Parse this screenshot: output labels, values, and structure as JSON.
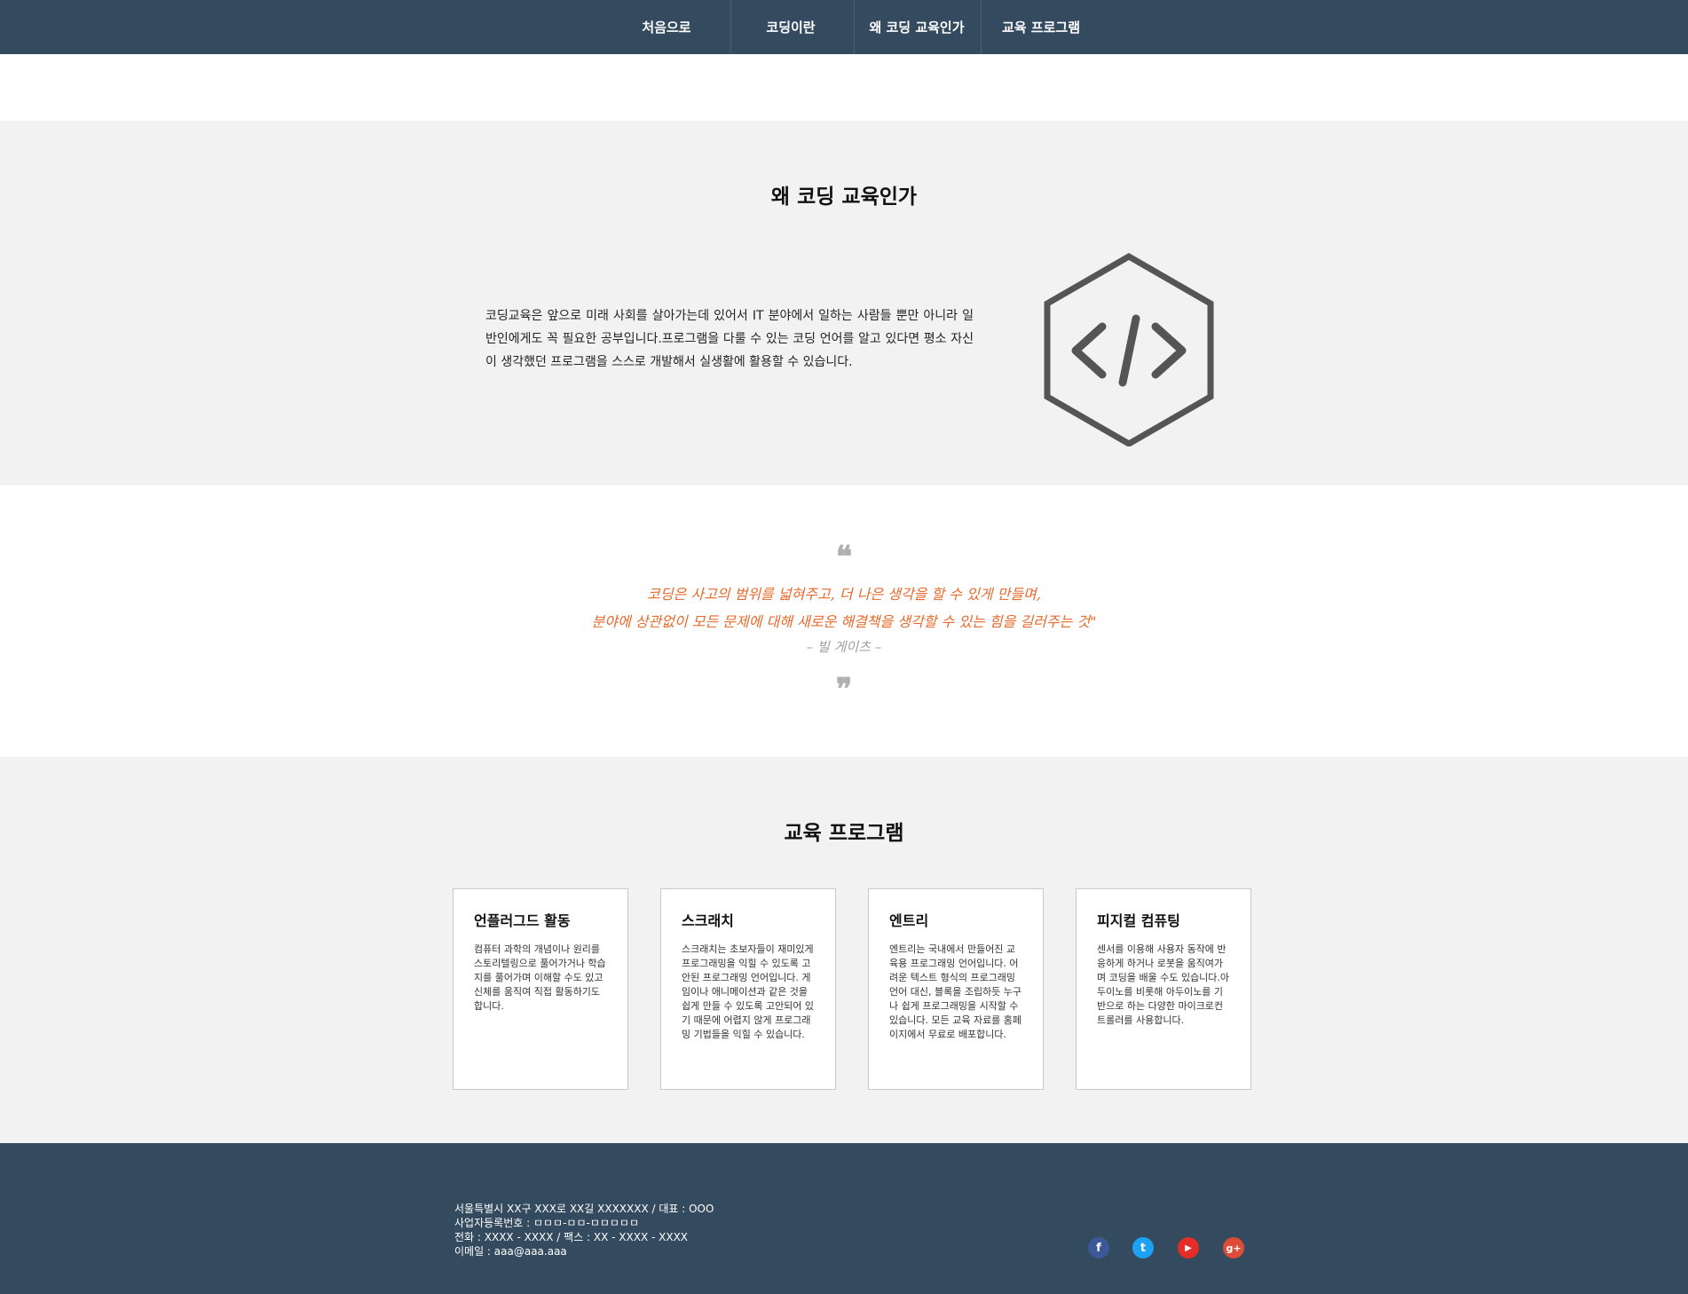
{
  "nav": {
    "items": [
      {
        "label": "처음으로"
      },
      {
        "label": "코딩이란"
      },
      {
        "label": "왜 코딩 교육인가"
      },
      {
        "label": "교육 프로그램"
      }
    ]
  },
  "why": {
    "title": "왜 코딩 교육인가",
    "text": "코딩교육은 앞으로 미래 사회를 살아가는데 있어서 IT 분야에서 일하는 사람들 뿐만 아니라 일반인에게도 꼭 필요한 공부입니다.프로그램을 다룰 수 있는 코딩 언어를 알고 있다면 평소 자신이 생각했던 프로그램을 스스로 개발해서 실생활에 활용할 수 있습니다.",
    "icon": "code-hexagon-icon"
  },
  "quote": {
    "open_mark": "❝",
    "line1": "코딩은 사고의 범위를 넓혀주고, 더 나은 생각을 할 수 있게 만들며,",
    "line2": "분야에 상관없이 모든 문제에 대해 새로운 해결책을 생각할 수 있는 힘을 길러주는 것\"",
    "author": "– 빌 게이츠 –",
    "close_mark": "❞",
    "accent_color": "#e8692c"
  },
  "programs": {
    "title": "교육 프로그램",
    "cards": [
      {
        "title": "언플러그드 활동",
        "body": "컴퓨터 과학의 개념이나 원리를 스토리텔링으로 풀어가거나 학습지를 풀어가며 이해할 수도 있고 신체를 움직여 직접 활동하기도 합니다."
      },
      {
        "title": "스크래치",
        "body": "스크래치는 초보자들이 재미있게 프로그래밍을 익힐 수 있도록 고안된 프로그래밍 언어입니다. 게임이나 애니메이션과 같은 것을 쉽게 만들 수 있도록 고안되어 있기 때문에 어렵지 않게 프로그래밍 기법들을 익힐 수 있습니다."
      },
      {
        "title": "엔트리",
        "body": "엔트리는 국내에서 만들어진 교육용 프로그래밍 언어입니다. 어려운 텍스트 형식의 프로그래밍 언어 대신, 블록을 조립하듯 누구나 쉽게 프로그래밍을 시작할 수 있습니다. 모든 교육 자료를 홈페이지에서 무료로 배포합니다."
      },
      {
        "title": "피지컬 컴퓨팅",
        "body": "센서를 이용해 사용자 동작에 반응하게 하거나 로봇을 움직여가며 코딩을 배울 수도 있습니다.아두이노를 비롯해 아두이노를 기반으로 하는 다양한 마이크로컨트롤러를 사용합니다."
      }
    ]
  },
  "footer": {
    "lines": [
      "서울특별시 XX구 XXX로 XX길 XXXXXXX / 대표 : OOO",
      "사업자등록번호 : ㅁㅁㅁ-ㅁㅁ-ㅁㅁㅁㅁㅁ",
      "전화 : XXXX - XXXX / 팩스 : XX - XXXX - XXXX",
      "이메일 : aaa@aaa.aaa"
    ],
    "social": [
      {
        "icon": "facebook-icon",
        "glyph": "f",
        "color": "#3b5998"
      },
      {
        "icon": "twitter-icon",
        "glyph": "t",
        "color": "#1da1f2"
      },
      {
        "icon": "youtube-icon",
        "glyph": "▶",
        "color": "#e52d27"
      },
      {
        "icon": "google-plus-icon",
        "glyph": "g+",
        "color": "#dd4b39"
      }
    ]
  },
  "colors": {
    "nav_bg": "#344a5f",
    "section_bg": "#f2f2f2",
    "icon_gray": "#555555"
  }
}
